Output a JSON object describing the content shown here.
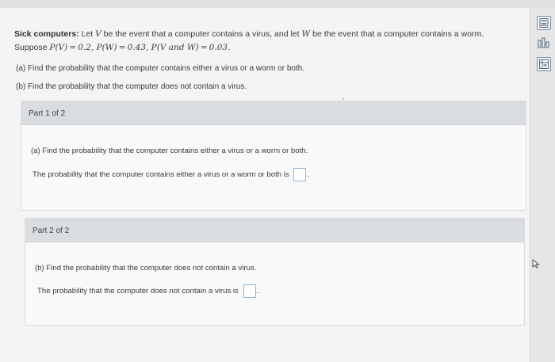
{
  "problem": {
    "title": "Sick computers:",
    "intro_a": " Let ",
    "var_V": "V",
    "intro_b": " be the event that a computer contains a virus, and let ",
    "var_W": "W",
    "intro_c": " be the event that a computer contains a worm.",
    "suppose_label": "Suppose ",
    "suppose_math": "P(V) = 0.2, P(W) = 0.43, P(V and W) = 0.03.",
    "question_a": "(a) Find the probability that the computer contains either a virus or a worm or both.",
    "question_b": "(b) Find the probability that the computer does not contain a virus."
  },
  "part1": {
    "header": "Part 1 of 2",
    "question": "(a) Find the probability that the computer contains either a virus or a worm or both.",
    "answer_prompt": "The probability that the computer contains either a virus or a worm or both is",
    "answer_value": "",
    "end_punct": "."
  },
  "part2": {
    "header": "Part 2 of 2",
    "question": "(b) Find the probability that the computer does not contain a virus.",
    "answer_prompt": "The probability that the computer does not contain a virus is",
    "answer_value": "",
    "end_punct": "."
  },
  "tools": [
    "calculator-icon",
    "chart-icon",
    "table-icon"
  ],
  "colors": {
    "header_bg": "#d9dde1",
    "answer_border": "#8cb4d6",
    "page_bg": "#f4f4f4"
  }
}
